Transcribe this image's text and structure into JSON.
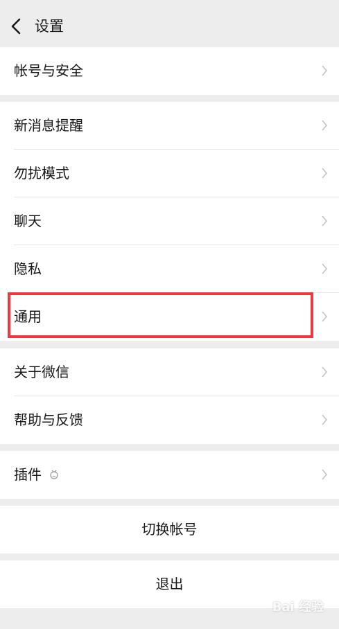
{
  "header": {
    "title": "设置",
    "back_icon": "chevron-left-icon"
  },
  "groups": [
    {
      "items": [
        {
          "label": "帐号与安全"
        }
      ]
    },
    {
      "items": [
        {
          "label": "新消息提醒"
        },
        {
          "label": "勿扰模式"
        },
        {
          "label": "聊天"
        },
        {
          "label": "隐私"
        },
        {
          "label": "通用"
        }
      ]
    },
    {
      "items": [
        {
          "label": "关于微信"
        },
        {
          "label": "帮助与反馈"
        }
      ]
    },
    {
      "items": [
        {
          "label": "插件",
          "icon": "plugin-icon"
        }
      ]
    }
  ],
  "actions": {
    "switch_account": "切换帐号",
    "logout": "退出"
  },
  "highlight": {
    "target": "通用",
    "color": "#f0363e"
  },
  "watermark": {
    "text": "Bai 经验"
  }
}
